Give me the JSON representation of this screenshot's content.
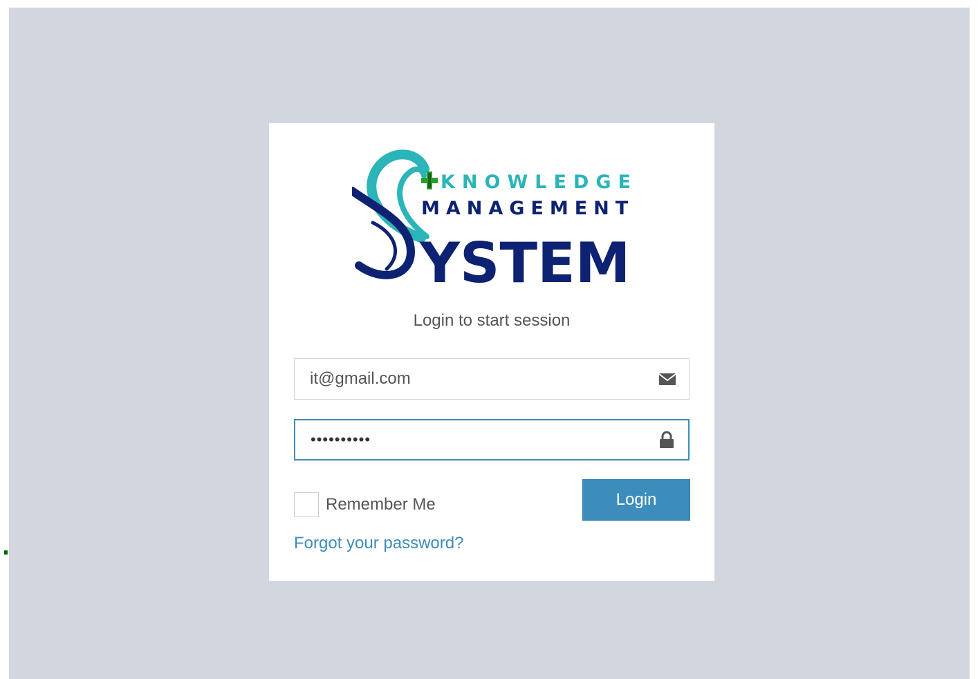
{
  "brand": {
    "logo_line1": "KNOWLEDGE",
    "logo_line2": "MANAGEMENT",
    "logo_line3": "YSTEM",
    "colors": {
      "teal": "#2bb5b8",
      "navy": "#0d2272",
      "green": "#2a9d2a"
    }
  },
  "login": {
    "message": "Login to start session",
    "email_value": "it@gmail.com",
    "email_icon": "envelope-icon",
    "password_value": "••••••••••",
    "password_icon": "lock-icon",
    "remember_label": "Remember Me",
    "remember_checked": false,
    "submit_label": "Login",
    "forgot_label": "Forgot your password?"
  },
  "theme": {
    "page_bg": "#d2d6de",
    "box_bg": "#ffffff",
    "primary": "#3c8dbc",
    "text": "#555555"
  }
}
